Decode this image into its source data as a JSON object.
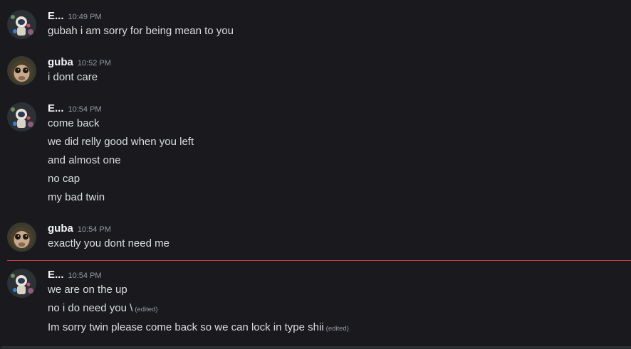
{
  "colors": {
    "background": "#1a1a1e",
    "username": "#f2f3f5",
    "message_text": "#dbdee1",
    "timestamp": "#949ba4",
    "new_messages_divider": "#c13b43"
  },
  "messages": [
    {
      "author": "E...",
      "avatar_icon": "astronaut-avatar-icon",
      "time": "10:49 PM",
      "lines": [
        {
          "text": "gubah i am sorry for being mean to you",
          "edited": ""
        }
      ]
    },
    {
      "author": "guba",
      "avatar_icon": "monkey-avatar-icon",
      "time": "10:52 PM",
      "lines": [
        {
          "text": "i dont care",
          "edited": ""
        }
      ]
    },
    {
      "author": "E...",
      "avatar_icon": "astronaut-avatar-icon",
      "time": "10:54 PM",
      "lines": [
        {
          "text": "come back",
          "edited": ""
        },
        {
          "text": "we did relly good when you left",
          "edited": ""
        },
        {
          "text": "and almost one",
          "edited": ""
        },
        {
          "text": "no cap",
          "edited": ""
        },
        {
          "text": "my bad twin",
          "edited": ""
        }
      ]
    },
    {
      "author": "guba",
      "avatar_icon": "monkey-avatar-icon",
      "time": "10:54 PM",
      "lines": [
        {
          "text": "exactly you dont need me",
          "edited": ""
        }
      ]
    },
    {
      "author": "E...",
      "avatar_icon": "astronaut-avatar-icon",
      "time": "10:54 PM",
      "lines": [
        {
          "text": "we are on the up",
          "edited": ""
        },
        {
          "text": "no i do need you \\",
          "edited": "(edited)"
        },
        {
          "text": "Im sorry twin please come back so we can lock in type shii",
          "edited": "(edited)"
        }
      ]
    }
  ]
}
